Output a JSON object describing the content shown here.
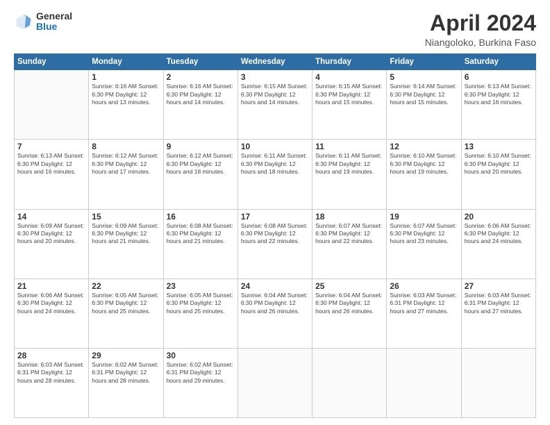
{
  "logo": {
    "general": "General",
    "blue": "Blue"
  },
  "header": {
    "title": "April 2024",
    "subtitle": "Niangoloko, Burkina Faso"
  },
  "weekdays": [
    "Sunday",
    "Monday",
    "Tuesday",
    "Wednesday",
    "Thursday",
    "Friday",
    "Saturday"
  ],
  "weeks": [
    [
      {
        "day": null,
        "info": null
      },
      {
        "day": "1",
        "info": "Sunrise: 6:16 AM\nSunset: 6:30 PM\nDaylight: 12 hours\nand 13 minutes."
      },
      {
        "day": "2",
        "info": "Sunrise: 6:16 AM\nSunset: 6:30 PM\nDaylight: 12 hours\nand 14 minutes."
      },
      {
        "day": "3",
        "info": "Sunrise: 6:15 AM\nSunset: 6:30 PM\nDaylight: 12 hours\nand 14 minutes."
      },
      {
        "day": "4",
        "info": "Sunrise: 6:15 AM\nSunset: 6:30 PM\nDaylight: 12 hours\nand 15 minutes."
      },
      {
        "day": "5",
        "info": "Sunrise: 6:14 AM\nSunset: 6:30 PM\nDaylight: 12 hours\nand 15 minutes."
      },
      {
        "day": "6",
        "info": "Sunrise: 6:13 AM\nSunset: 6:30 PM\nDaylight: 12 hours\nand 16 minutes."
      }
    ],
    [
      {
        "day": "7",
        "info": "Sunrise: 6:13 AM\nSunset: 6:30 PM\nDaylight: 12 hours\nand 16 minutes."
      },
      {
        "day": "8",
        "info": "Sunrise: 6:12 AM\nSunset: 6:30 PM\nDaylight: 12 hours\nand 17 minutes."
      },
      {
        "day": "9",
        "info": "Sunrise: 6:12 AM\nSunset: 6:30 PM\nDaylight: 12 hours\nand 18 minutes."
      },
      {
        "day": "10",
        "info": "Sunrise: 6:11 AM\nSunset: 6:30 PM\nDaylight: 12 hours\nand 18 minutes."
      },
      {
        "day": "11",
        "info": "Sunrise: 6:11 AM\nSunset: 6:30 PM\nDaylight: 12 hours\nand 19 minutes."
      },
      {
        "day": "12",
        "info": "Sunrise: 6:10 AM\nSunset: 6:30 PM\nDaylight: 12 hours\nand 19 minutes."
      },
      {
        "day": "13",
        "info": "Sunrise: 6:10 AM\nSunset: 6:30 PM\nDaylight: 12 hours\nand 20 minutes."
      }
    ],
    [
      {
        "day": "14",
        "info": "Sunrise: 6:09 AM\nSunset: 6:30 PM\nDaylight: 12 hours\nand 20 minutes."
      },
      {
        "day": "15",
        "info": "Sunrise: 6:09 AM\nSunset: 6:30 PM\nDaylight: 12 hours\nand 21 minutes."
      },
      {
        "day": "16",
        "info": "Sunrise: 6:08 AM\nSunset: 6:30 PM\nDaylight: 12 hours\nand 21 minutes."
      },
      {
        "day": "17",
        "info": "Sunrise: 6:08 AM\nSunset: 6:30 PM\nDaylight: 12 hours\nand 22 minutes."
      },
      {
        "day": "18",
        "info": "Sunrise: 6:07 AM\nSunset: 6:30 PM\nDaylight: 12 hours\nand 22 minutes."
      },
      {
        "day": "19",
        "info": "Sunrise: 6:07 AM\nSunset: 6:30 PM\nDaylight: 12 hours\nand 23 minutes."
      },
      {
        "day": "20",
        "info": "Sunrise: 6:06 AM\nSunset: 6:30 PM\nDaylight: 12 hours\nand 24 minutes."
      }
    ],
    [
      {
        "day": "21",
        "info": "Sunrise: 6:06 AM\nSunset: 6:30 PM\nDaylight: 12 hours\nand 24 minutes."
      },
      {
        "day": "22",
        "info": "Sunrise: 6:05 AM\nSunset: 6:30 PM\nDaylight: 12 hours\nand 25 minutes."
      },
      {
        "day": "23",
        "info": "Sunrise: 6:05 AM\nSunset: 6:30 PM\nDaylight: 12 hours\nand 25 minutes."
      },
      {
        "day": "24",
        "info": "Sunrise: 6:04 AM\nSunset: 6:30 PM\nDaylight: 12 hours\nand 26 minutes."
      },
      {
        "day": "25",
        "info": "Sunrise: 6:04 AM\nSunset: 6:30 PM\nDaylight: 12 hours\nand 26 minutes."
      },
      {
        "day": "26",
        "info": "Sunrise: 6:03 AM\nSunset: 6:31 PM\nDaylight: 12 hours\nand 27 minutes."
      },
      {
        "day": "27",
        "info": "Sunrise: 6:03 AM\nSunset: 6:31 PM\nDaylight: 12 hours\nand 27 minutes."
      }
    ],
    [
      {
        "day": "28",
        "info": "Sunrise: 6:03 AM\nSunset: 6:31 PM\nDaylight: 12 hours\nand 28 minutes."
      },
      {
        "day": "29",
        "info": "Sunrise: 6:02 AM\nSunset: 6:31 PM\nDaylight: 12 hours\nand 28 minutes."
      },
      {
        "day": "30",
        "info": "Sunrise: 6:02 AM\nSunset: 6:31 PM\nDaylight: 12 hours\nand 29 minutes."
      },
      {
        "day": null,
        "info": null
      },
      {
        "day": null,
        "info": null
      },
      {
        "day": null,
        "info": null
      },
      {
        "day": null,
        "info": null
      }
    ]
  ]
}
